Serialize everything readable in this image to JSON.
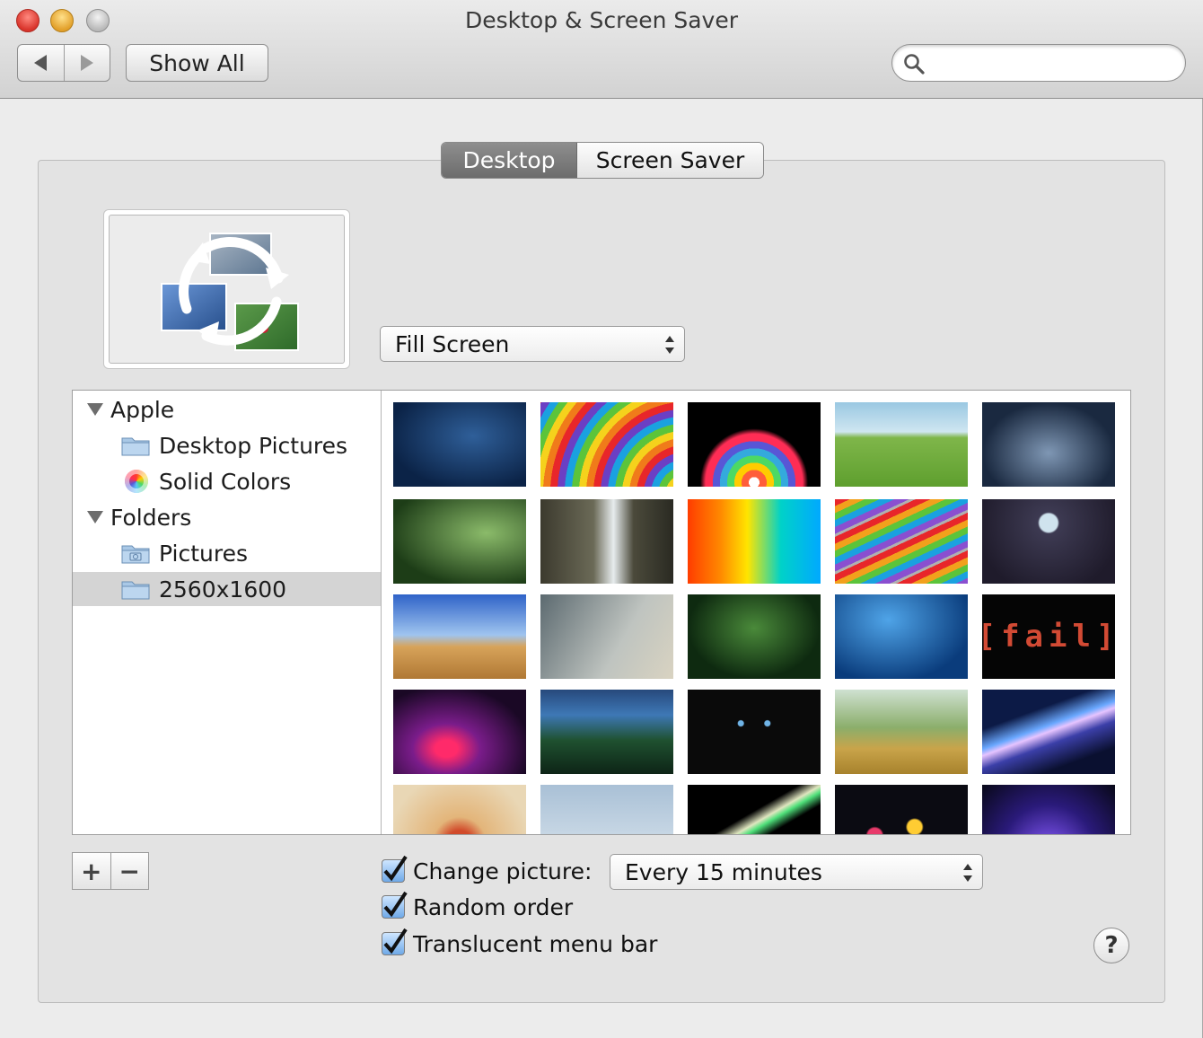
{
  "window": {
    "title": "Desktop & Screen Saver"
  },
  "toolbar": {
    "show_all_label": "Show All",
    "search_placeholder": ""
  },
  "tabs": [
    {
      "label": "Desktop",
      "selected": true
    },
    {
      "label": "Screen Saver",
      "selected": false
    }
  ],
  "fit_popup": {
    "value": "Fill Screen"
  },
  "sidebar": {
    "items": [
      {
        "label": "Apple",
        "type": "group"
      },
      {
        "label": "Desktop Pictures",
        "type": "folder"
      },
      {
        "label": "Solid Colors",
        "type": "colors"
      },
      {
        "label": "Folders",
        "type": "group"
      },
      {
        "label": "Pictures",
        "type": "pictures-folder"
      },
      {
        "label": "2560x1600",
        "type": "folder",
        "selected": true
      }
    ]
  },
  "thumbnails": [
    {
      "name": "dark-blue-texture"
    },
    {
      "name": "rainbow-spiral"
    },
    {
      "name": "color-petals"
    },
    {
      "name": "green-field"
    },
    {
      "name": "lego-stormtroopers"
    },
    {
      "name": "leaf-droplets"
    },
    {
      "name": "waterfall"
    },
    {
      "name": "color-pixels"
    },
    {
      "name": "colored-pencils"
    },
    {
      "name": "glass-marble"
    },
    {
      "name": "pyramids"
    },
    {
      "name": "water-drops-glass"
    },
    {
      "name": "dandelion"
    },
    {
      "name": "blue-droplets"
    },
    {
      "name": "fail-text",
      "text": "[fail]"
    },
    {
      "name": "purple-swirl"
    },
    {
      "name": "night-house"
    },
    {
      "name": "black-cat"
    },
    {
      "name": "tree-meadow"
    },
    {
      "name": "light-streaks"
    },
    {
      "name": "floral-art"
    },
    {
      "name": "snow-figures"
    },
    {
      "name": "neon-lines"
    },
    {
      "name": "bokeh-dark"
    },
    {
      "name": "bokeh-purple"
    }
  ],
  "options": {
    "change_picture_label": "Change picture:",
    "change_picture_checked": true,
    "interval_value": "Every 15 minutes",
    "random_order_label": "Random order",
    "random_order_checked": true,
    "translucent_label": "Translucent menu bar",
    "translucent_checked": true
  },
  "buttons": {
    "add": "+",
    "remove": "−",
    "help": "?"
  },
  "colors": {
    "selected_tab": "#7c7c7c",
    "checkbox": "#6fa9e8",
    "selection": "#d4d4d4"
  }
}
